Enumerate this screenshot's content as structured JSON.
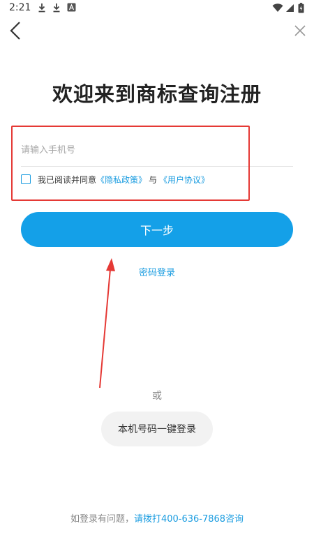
{
  "status_bar": {
    "time": "2:21"
  },
  "icons": {
    "back": "back-arrow-icon",
    "close": "close-icon",
    "download": "download-icon",
    "wifi": "wifi-icon",
    "signal": "signal-icon",
    "battery": "battery-icon"
  },
  "title": "欢迎来到商标查询注册",
  "phone_input": {
    "placeholder": "请输入手机号",
    "value": ""
  },
  "agreement": {
    "prefix": "我已阅读并同意",
    "privacy_link": "《隐私政策》",
    "separator": "与",
    "user_link": "《用户协议》",
    "checked": false
  },
  "next_button": "下一步",
  "password_login": "密码登录",
  "or_label": "或",
  "onekey_button": "本机号码一键登录",
  "help": {
    "text": "如登录有问题，",
    "link": "请拨打400-636-7868咨询"
  },
  "colors": {
    "accent": "#14a0e8",
    "annotation": "#e53935"
  }
}
